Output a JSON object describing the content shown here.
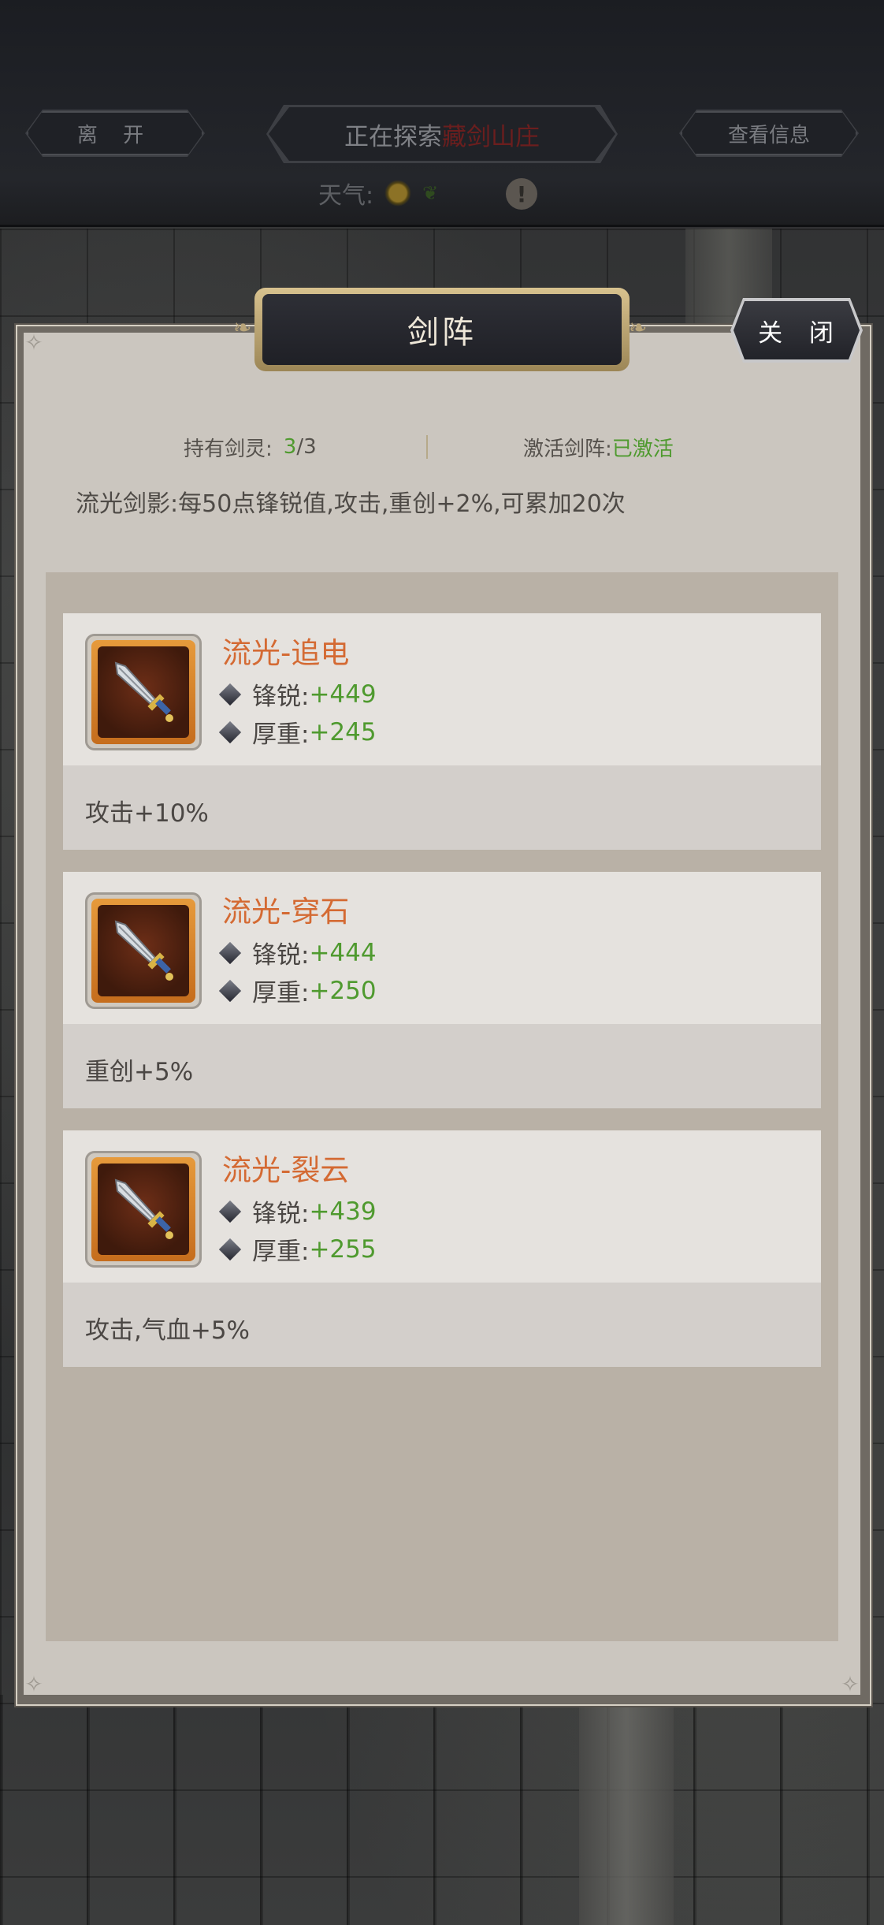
{
  "topbar": {
    "leave_label": "离 开",
    "explore_prefix": "正在探索",
    "explore_place": "藏剑山庄",
    "info_label": "查看信息",
    "weather_label": "天气:"
  },
  "panel": {
    "title": "剑阵",
    "close_label": "关 闭",
    "held_label": "持有剑灵:",
    "held_value": "3",
    "held_total": "/3",
    "activated_label": "激活剑阵:",
    "activated_value": "已激活",
    "effect_text": "流光剑影:每50点锋锐值,攻击,重创+2%,可累加20次"
  },
  "cards": [
    {
      "name": "流光-追电",
      "sharp_label": "锋锐:",
      "sharp_value": "+449",
      "heavy_label": "厚重:",
      "heavy_value": "+245",
      "effect": "攻击+10%"
    },
    {
      "name": "流光-穿石",
      "sharp_label": "锋锐:",
      "sharp_value": "+444",
      "heavy_label": "厚重:",
      "heavy_value": "+250",
      "effect": "重创+5%"
    },
    {
      "name": "流光-裂云",
      "sharp_label": "锋锐:",
      "sharp_value": "+439",
      "heavy_label": "厚重:",
      "heavy_value": "+255",
      "effect": "攻击,气血+5%"
    }
  ],
  "icons": {
    "sword": "sword-icon",
    "sun": "sun-icon",
    "leaf": "leaf-icon",
    "warning": "warning-icon",
    "diamond": "diamond-icon"
  },
  "colors": {
    "accent_orange": "#d46a33",
    "value_green": "#4f9a2f",
    "place_red": "#6b1e1e"
  }
}
